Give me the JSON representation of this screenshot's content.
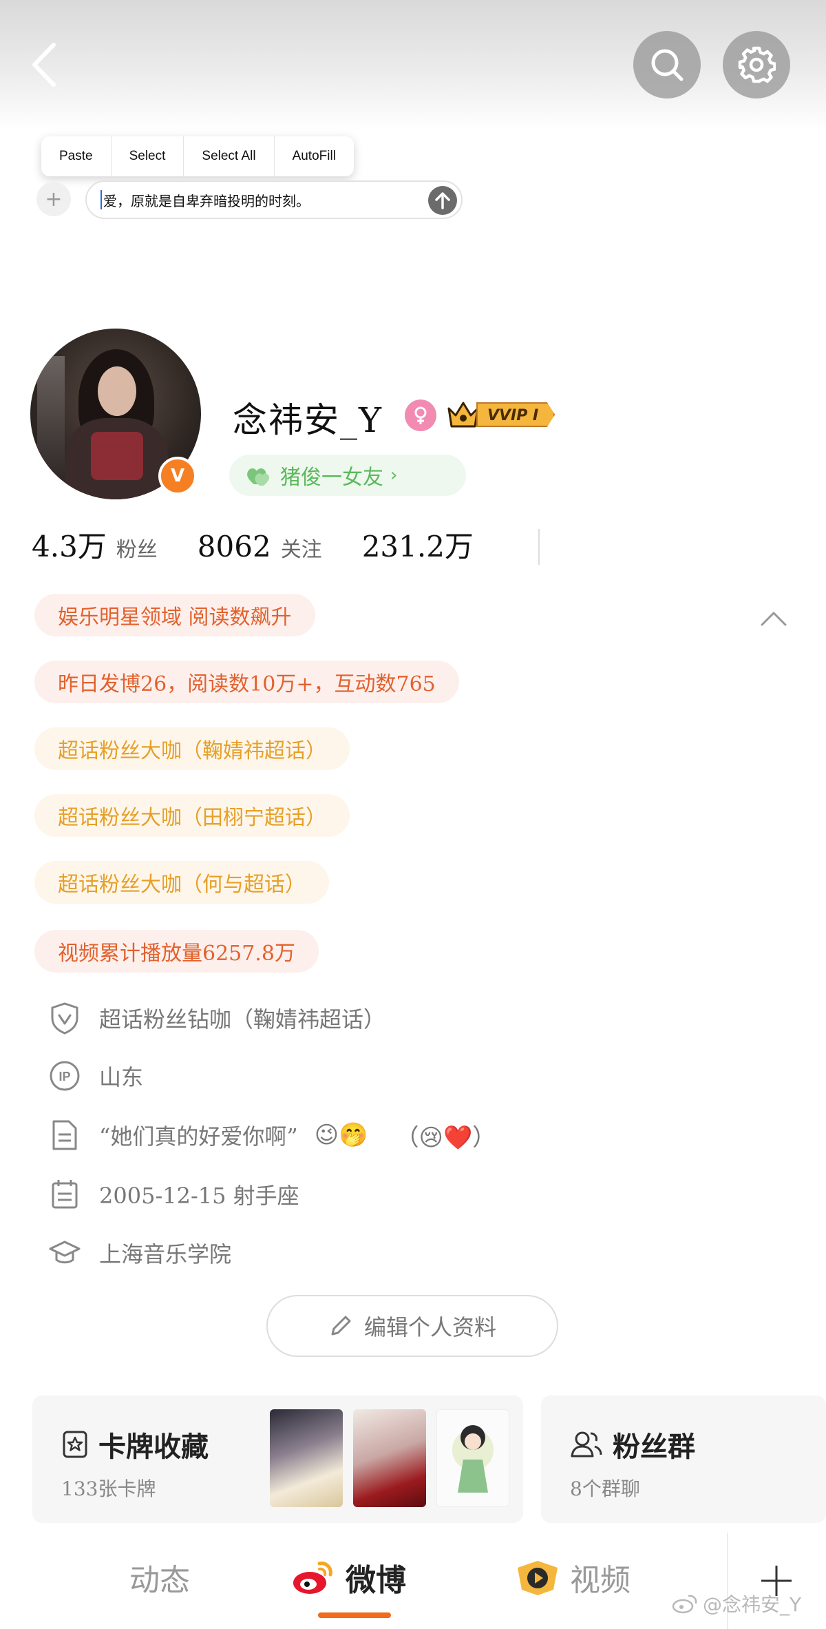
{
  "edit_menu": {
    "items": [
      "Paste",
      "Select",
      "Select All",
      "AutoFill"
    ]
  },
  "compose": {
    "text": "爱，原就是自卑弃暗投明的时刻。"
  },
  "profile": {
    "username": "念祎安_Y",
    "vip_label": "VVIP I",
    "title_pill": "猪俊一女友",
    "verify_letter": "V"
  },
  "stats": [
    {
      "value": "4.3万",
      "label": "粉丝"
    },
    {
      "value": "8062",
      "label": "关注"
    },
    {
      "value": "231.2万",
      "label": ""
    }
  ],
  "tags": [
    {
      "text": "娱乐明星领域 阅读数飙升",
      "style": "red"
    },
    {
      "text": "昨日发博26，阅读数10万+，互动数765",
      "style": "red"
    },
    {
      "text": "超话粉丝大咖（鞠婧祎超话）",
      "style": "gold"
    },
    {
      "text": "超话粉丝大咖（田栩宁超话）",
      "style": "gold"
    },
    {
      "text": "超话粉丝大咖（何与超话）",
      "style": "gold"
    },
    {
      "text": "视频累计播放量6257.8万",
      "style": "red"
    }
  ],
  "info": {
    "fandom": "超话粉丝钻咖（鞠婧祎超话）",
    "ip": "山东",
    "bio": "“她们真的好爱你啊”",
    "bio_emoji1": "😉🤭",
    "bio_tail": "（😢❤️）",
    "birthday": "2005-12-15 射手座",
    "school": "上海音乐学院"
  },
  "edit_profile_label": "编辑个人资料",
  "cards": {
    "collection_title": "卡牌收藏",
    "collection_sub": "133张卡牌",
    "fans_title": "粉丝群",
    "fans_sub": "8个群聊"
  },
  "nav": {
    "tab1": "动态",
    "tab2": "微博",
    "tab3": "视频"
  },
  "watermark": "@念祎安_Y",
  "colors": {
    "accent": "#f26a1b",
    "tag_red": "#e2612e",
    "tag_gold": "#e6a02a",
    "title_green": "#5cb85c"
  }
}
